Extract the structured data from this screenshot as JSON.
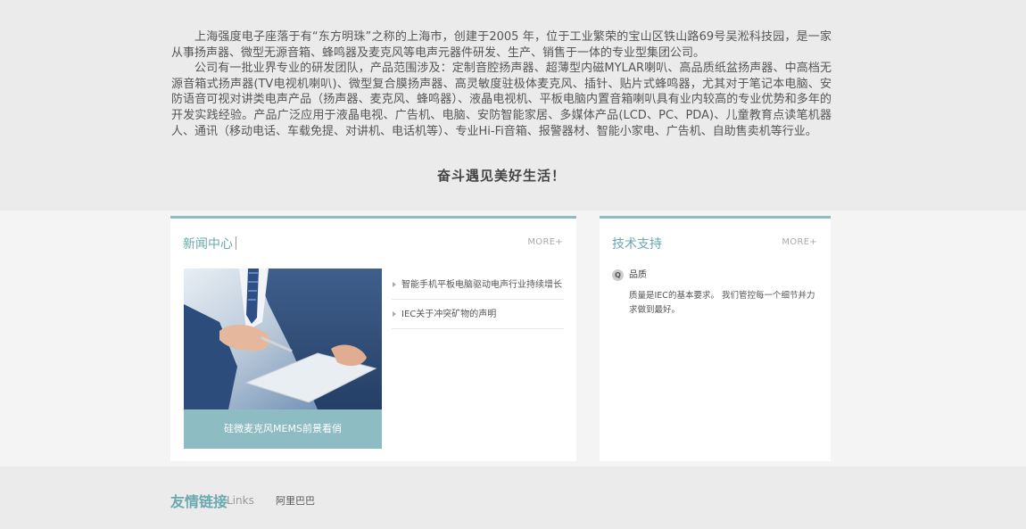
{
  "intro": {
    "paragraphs": [
      "上海强度电子座落于有“东方明珠”之称的上海市，创建于2005 年，位于工业繁荣的宝山区铁山路69号吴淞科技园，是一家从事扬声器、微型无源音箱、蜂鸣器及麦克风等电声元器件研发、生产、销售于一体的专业型集团公司。",
      "公司有一批业界专业的研发团队，产品范围涉及：定制音腔扬声器、超薄型内磁MYLAR喇叭、高品质纸盆扬声器、中高档无源音箱式扬声器(TV电视机喇叭)、微型复合膜扬声器、高灵敏度驻极体麦克风、插针、贴片式蜂鸣器，尤其对于笔记本电脑、安防语音可视对讲类电声产品（扬声器、麦克风、蜂鸣器）、液晶电视机、平板电脑内置音箱喇叭具有业内较高的专业优势和多年的开发实践经验。产品广泛应用于液晶电视、广告机、电脑、安防智能家居、多媒体产品(LCD、PC、PDA)、儿童教育点读笔机器人、通讯（移动电话、车载免提、对讲机、电话机等）、专业Hi-Fi音箱、报警器材、智能小家电、广告机、自助售卖机等行业。"
    ],
    "slogan": "奋斗遇见美好生活！"
  },
  "news": {
    "title": "新闻中心",
    "more": "MORE+",
    "caption": "硅微麦克风MEMS前景看俏",
    "items": [
      "智能手机平板电脑驱动电声行业持续增长",
      "IEC关于冲突矿物的声明"
    ]
  },
  "tech": {
    "title": "技术支持",
    "more": "MORE+",
    "q_icon": "Q",
    "question": "品质",
    "answer": "质量是IEC的基本要求。 我们管控每一个细节并力求做到最好。"
  },
  "links": {
    "title": "友情链接",
    "subtitle": "Links",
    "items": [
      "阿里巴巴"
    ]
  },
  "colors": {
    "accent": "#8dbcc2",
    "title_color": "#6aa9ae",
    "intro_bg": "#ebebeb",
    "main_bg": "#f4f4f4"
  }
}
